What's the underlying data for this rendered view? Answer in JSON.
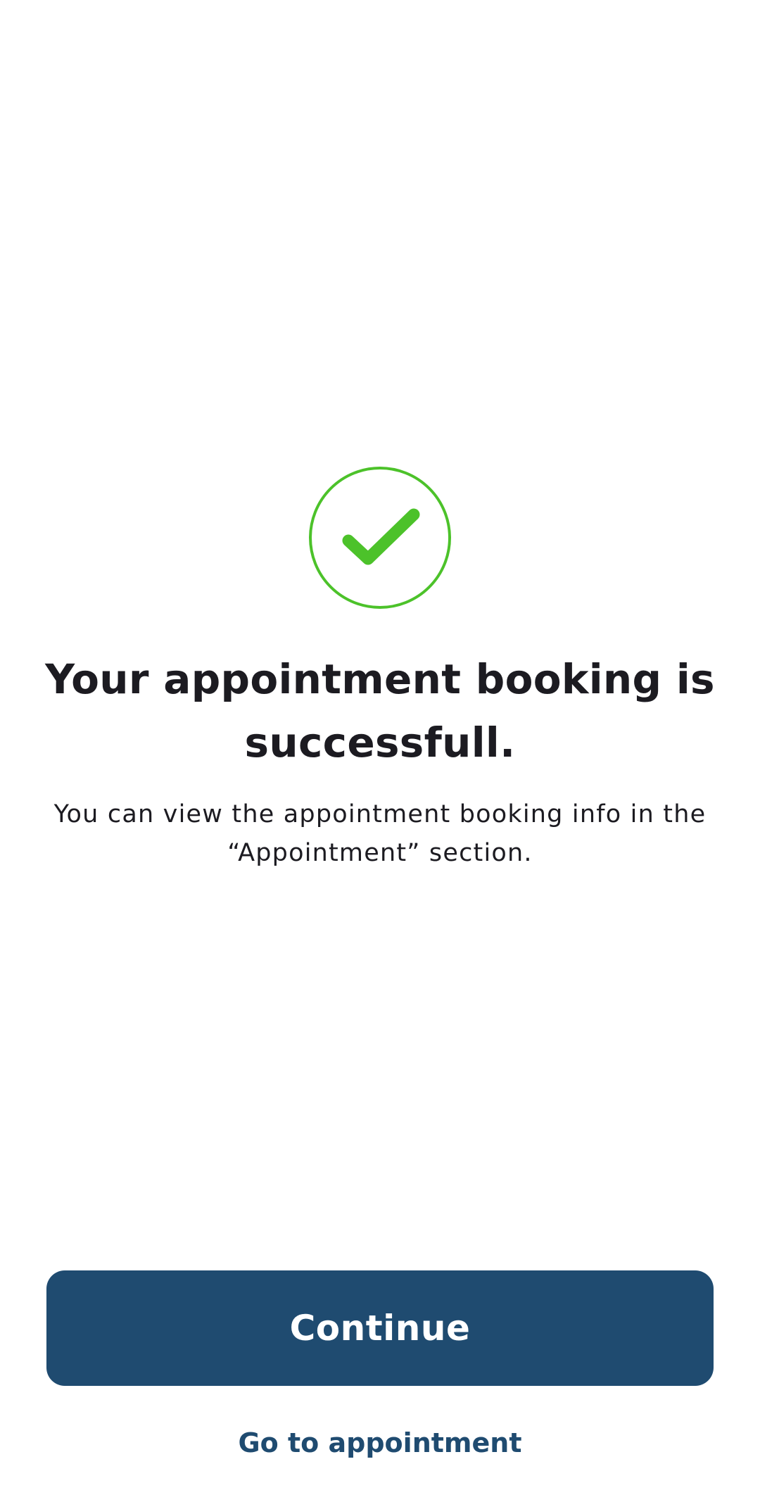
{
  "colors": {
    "success_green": "#4cc22a",
    "primary_blue": "#1f4b70",
    "text_dark": "#1c1b21",
    "background": "#ffffff"
  },
  "icon": {
    "name": "check-circle-icon"
  },
  "message": {
    "title": "Your appointment booking is successfull.",
    "subtitle": "You can view the appointment booking info in the “Appointment” section."
  },
  "actions": {
    "continue_label": "Continue",
    "go_to_appointment_label": "Go to appointment"
  }
}
